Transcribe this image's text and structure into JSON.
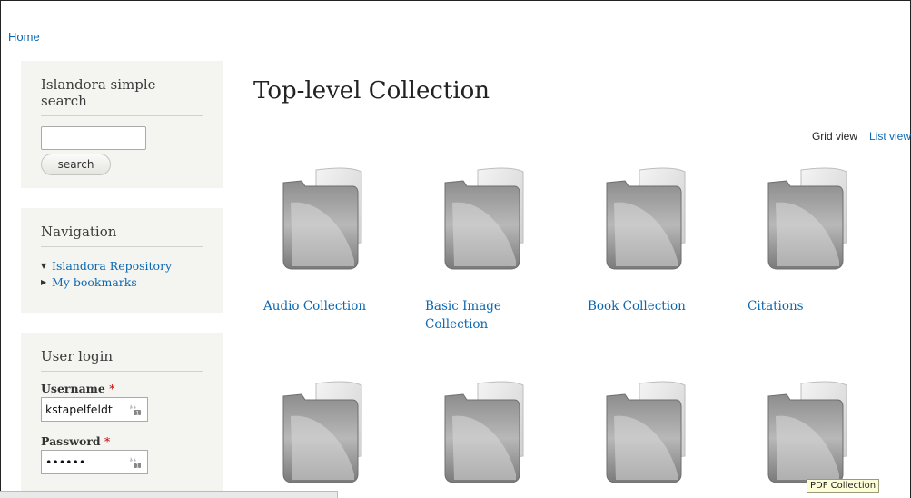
{
  "breadcrumb": {
    "home": "Home"
  },
  "search_block": {
    "title": "Islandora simple search",
    "input_value": "",
    "button_label": "search"
  },
  "navigation_block": {
    "title": "Navigation",
    "items": [
      {
        "label": "Islandora Repository",
        "expanded": true
      },
      {
        "label": "My bookmarks",
        "expanded": false
      }
    ]
  },
  "login_block": {
    "title": "User login",
    "username_label": "Username",
    "username_value": "kstapelfeldt",
    "password_label": "Password",
    "password_value": "••••••",
    "required_mark": "*"
  },
  "main": {
    "title": "Top-level Collection",
    "view_grid": "Grid view",
    "view_list": "List view",
    "collections": [
      {
        "label": "Audio Collection"
      },
      {
        "label": "Basic Image Collection"
      },
      {
        "label": "Book Collection"
      },
      {
        "label": "Citations"
      },
      {
        "label": ""
      },
      {
        "label": ""
      },
      {
        "label": ""
      },
      {
        "label": ""
      }
    ]
  },
  "tooltip": {
    "text": "PDF Collection"
  },
  "icons": {
    "folder": "folder-icon",
    "password_key": "key-icon",
    "nav_expanded": "triangle-down-icon",
    "nav_collapsed": "triangle-right-icon"
  },
  "colors": {
    "link": "#0b67b2",
    "sidebar_bg": "#f4f4f0",
    "required": "#cc0000"
  }
}
